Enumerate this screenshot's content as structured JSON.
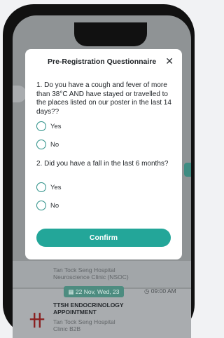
{
  "modal": {
    "title": "Pre-Registration Questionnaire",
    "close_icon": "close-icon",
    "questions": [
      {
        "text": "1. Do you have a cough and fever of more than 38°C AND have stayed or travelled to the places listed on our poster in the last 14 days??",
        "options": [
          "Yes",
          "No"
        ]
      },
      {
        "text": "2. Did you have a fall in the last 6 months?",
        "options": [
          "Yes",
          "No"
        ]
      }
    ],
    "confirm_label": "Confirm"
  },
  "background": {
    "appointment_1": {
      "clinic_line1": "Tan Tock Seng Hospital",
      "clinic_line2": "Neuroscience Clinic (NSOC)"
    },
    "appointment_2": {
      "date": "22 Nov, Wed, 23",
      "time": "09:00 AM",
      "title": "TTSH ENDOCRINOLOGY APPOINTMENT",
      "clinic_line1": "Tan Tock Seng Hospital",
      "clinic_line2": "Clinic B2B"
    }
  },
  "colors": {
    "accent": "#23a699",
    "radio_border": "#2a8f86",
    "overlay": "#8f9395"
  }
}
